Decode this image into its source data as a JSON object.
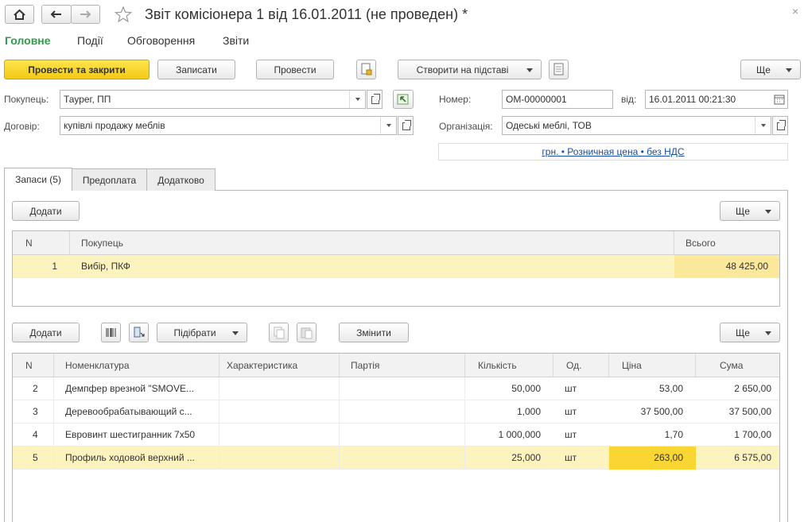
{
  "window": {
    "title": "Звіт комісіонера 1 від 16.01.2011 (не проведен) *"
  },
  "nav": {
    "tabs": [
      "Головне",
      "Події",
      "Обговорення",
      "Звіти"
    ]
  },
  "toolbar": {
    "post_close": "Провести та закрити",
    "save": "Записати",
    "post": "Провести",
    "create_based": "Створити на підставі",
    "more": "Ще"
  },
  "form": {
    "buyer_label": "Покупець:",
    "buyer_value": "Таурег, ПП",
    "contract_label": "Договір:",
    "contract_value": "купівлі продажу меблів",
    "number_label": "Номер:",
    "number_value": "ОМ-00000001",
    "from_label": "від:",
    "date_value": "16.01.2011 00:21:30",
    "org_label": "Організація:",
    "org_value": "Одеські меблі, ТОВ",
    "price_link": "грн. • Розничная цена • без НДС"
  },
  "tabs": {
    "items": [
      "Запаси (5)",
      "Предоплата",
      "Додатково"
    ]
  },
  "upper": {
    "add": "Додати",
    "more": "Ще",
    "columns": [
      "N",
      "Покупець",
      "Всього"
    ],
    "rows": [
      {
        "n": "1",
        "buyer": "Вибір, ПКФ",
        "total": "48 425,00"
      }
    ]
  },
  "lower": {
    "add": "Додати",
    "pick": "Підібрати",
    "change": "Змінити",
    "more": "Ще",
    "columns": [
      "N",
      "Номенклатура",
      "Характеристика",
      "Партія",
      "Кількість",
      "Од.",
      "Ціна",
      "Сума"
    ],
    "rows": [
      {
        "n": "2",
        "name": "Демпфер врезной \"SMOVE...",
        "char": "",
        "batch": "",
        "qty": "50,000",
        "unit": "шт",
        "price": "53,00",
        "sum": "2 650,00"
      },
      {
        "n": "3",
        "name": "Деревообрабатывающий с...",
        "char": "",
        "batch": "",
        "qty": "1,000",
        "unit": "шт",
        "price": "37 500,00",
        "sum": "37 500,00"
      },
      {
        "n": "4",
        "name": "Евровинт шестигранник 7х50",
        "char": "",
        "batch": "",
        "qty": "1 000,000",
        "unit": "шт",
        "price": "1,70",
        "sum": "1 700,00"
      },
      {
        "n": "5",
        "name": "Профиль ходовой верхний ...",
        "char": "",
        "batch": "",
        "qty": "25,000",
        "unit": "шт",
        "price": "263,00",
        "sum": "6 575,00"
      }
    ]
  },
  "colors": {
    "accent_green": "#2d9d4b",
    "primary_yellow": "#f4c917",
    "selected_row": "#fdf3bf",
    "selected_cell": "#fad632"
  }
}
